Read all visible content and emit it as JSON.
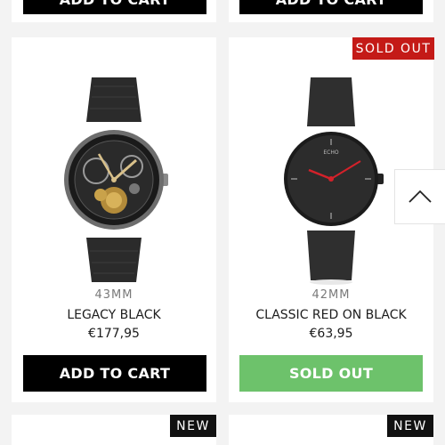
{
  "top_row": {
    "left_button_label": "ADD TO CART",
    "right_button_label": "ADD TO CART"
  },
  "products": [
    {
      "size": "43MM",
      "name": "LEGACY BLACK",
      "price": "€177,95",
      "button_label": "ADD TO CART",
      "image": "skeleton-automatic-watch-black-leather-strap"
    },
    {
      "badge": "SOLD OUT",
      "size": "42MM",
      "name": "CLASSIC RED ON BLACK",
      "price": "€63,95",
      "button_label": "SOLD OUT",
      "image": "black-minimalist-watch-red-hands",
      "dial_brand": "ECHO"
    }
  ],
  "bottom_row": {
    "left_badge": "NEW",
    "right_badge": "NEW"
  },
  "scroll_to_top": {
    "icon": "chevron-up-icon"
  },
  "colors": {
    "page_background": "#f3f3f3",
    "add_to_cart": "#000000",
    "sold_out_button": "#6dc26b",
    "sold_out_badge": "#c41a17",
    "new_badge": "#111111"
  }
}
